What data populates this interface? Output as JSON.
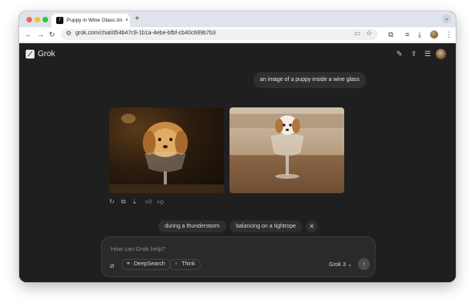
{
  "browser": {
    "tab_title": "Puppy in Wine Glass Image G",
    "tab_close": "×",
    "new_tab": "+",
    "url": "grok.com/chat/d54b47c9-1b1a-4ebe-bfbf-cb40c689b7b3"
  },
  "app": {
    "name": "Grok",
    "logo_glyph": "⟋"
  },
  "chat": {
    "user_message": "an image of a puppy inside a wine glass"
  },
  "suggestions": [
    "during a thunderstorm",
    "balancing on a tightrope"
  ],
  "composer": {
    "placeholder": "How can Grok help?",
    "deepsearch_label": "DeepSearch",
    "think_label": "Think",
    "model_label": "Grok 3"
  },
  "icons": {
    "back": "back-arrow-icon",
    "forward": "forward-arrow-icon",
    "reload": "reload-icon",
    "edit": "edit-icon",
    "share": "share-icon",
    "history": "history-icon"
  },
  "colors": {
    "app_bg": "#1f1f20",
    "bubble_bg": "#2f2f30",
    "chrome_tabstrip": "#dfe3eb"
  }
}
